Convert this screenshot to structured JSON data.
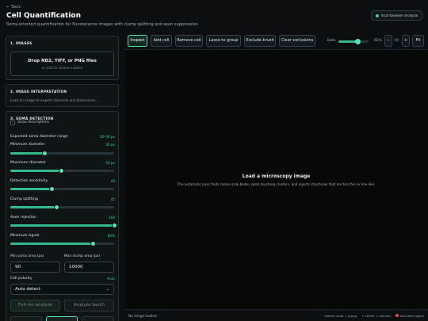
{
  "header": {
    "back_label": "← Tools",
    "title": "Cell Quantification",
    "subtitle": "Soma-oriented quantification for fluorescence images with clump splitting and axon suppression",
    "badge": "local browser analysis"
  },
  "images": {
    "title": "1. IMAGES",
    "drop_main": "Drop ND2, TIFF, or PNG files",
    "drop_sub": "or click to choose a batch"
  },
  "interpretation": {
    "title": "2. IMAGE INTERPRETATION",
    "text": "Load an image to inspect channels and dimensions."
  },
  "soma": {
    "title": "3. SOMA DETECTION",
    "show_descriptions": "Show descriptions",
    "expected_range_label": "Expected soma diameter range",
    "expected_range_value": "30–50 px",
    "min_diameter_label": "Minimum diameter",
    "min_diameter_value": "30 px",
    "min_diameter": 0.33,
    "max_diameter_label": "Maximum diameter",
    "max_diameter_value": "50 px",
    "max_diameter": 0.49,
    "sensitivity_label": "Detection sensitivity",
    "sensitivity_value": "40",
    "sensitivity": 0.4,
    "clump_label": "Clump splitting",
    "clump_value": "45",
    "clump": 0.45,
    "axon_label": "Axon rejection",
    "axon_value": "100",
    "axon": 1.0,
    "min_signal_label": "Minimum signal",
    "min_signal_value": "80%",
    "min_signal": 0.8,
    "min_area_label": "Min soma area (px)",
    "min_area_value": "90",
    "max_clump_label": "Max clump area (px)",
    "max_clump_value": "10000",
    "polarity_label": "Cell polarity",
    "polarity_value": "Auto",
    "polarity_select": "Auto detect",
    "full_res_label": "Full-res analyze",
    "batch_label": "Analyze batch"
  },
  "toolbar": {
    "inspect": "Inspect",
    "add_cell": "Add cell",
    "remove_cell": "Remove cell",
    "lasso": "Lasso to group",
    "exclude": "Exclude brush",
    "clear": "Clear exclusions",
    "zoom_label": "Data",
    "zoom_value": "65%",
    "zoom": 0.65,
    "minus": "−",
    "fit_small": "Fit",
    "plus": "+",
    "fit": "Fit"
  },
  "canvas": {
    "empty_title": "Load a microscopy image",
    "empty_sub": "The automatic pass finds soma-scale blobs, splits touching clusters, and rejects structures that are too thin or line-like."
  },
  "status": {
    "left": "No image loaded.",
    "hint1": "marker color = group",
    "hint2": "+ center = manual",
    "hint3": "excluded region"
  },
  "colors": {
    "accent": "#3fd0a0",
    "excluded": "#e04b5a"
  }
}
